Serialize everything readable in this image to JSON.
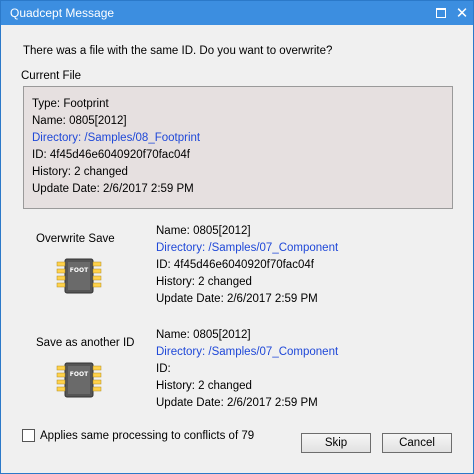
{
  "window": {
    "title": "Quadcept Message"
  },
  "question": "There was a file with the same ID. Do you want to overwrite?",
  "current_file": {
    "label": "Current File",
    "type": "Type: Footprint",
    "name": "Name: 0805[2012]",
    "directory": "Directory: /Samples/08_Footprint",
    "id": "ID: 4f45d46e6040920f70fac04f",
    "history": "History: 2 changed",
    "update_date": "Update Date: 2/6/2017 2:59 PM"
  },
  "options": [
    {
      "label": "Overwrite Save",
      "icon": "chip-icon",
      "chip_text": "FOOT",
      "name": "Name: 0805[2012]",
      "directory": "Directory: /Samples/07_Component",
      "id": "ID: 4f45d46e6040920f70fac04f",
      "history": "History: 2 changed",
      "update_date": "Update Date: 2/6/2017 2:59 PM"
    },
    {
      "label": "Save as another ID",
      "icon": "chip-icon",
      "chip_text": "FOOT",
      "name": "Name: 0805[2012]",
      "directory": "Directory: /Samples/07_Component",
      "id": "ID:",
      "history": "History: 2 changed",
      "update_date": "Update Date: 2/6/2017 2:59 PM"
    }
  ],
  "apply_all": {
    "label": "Applies same processing to conflicts of 79",
    "checked": false
  },
  "buttons": {
    "skip": "Skip",
    "cancel": "Cancel"
  },
  "colors": {
    "titlebar": "#3c8ee0",
    "link": "#1f48d8",
    "current_box_bg": "#e6e0e0",
    "dialog_bg": "#f0f0f0"
  }
}
